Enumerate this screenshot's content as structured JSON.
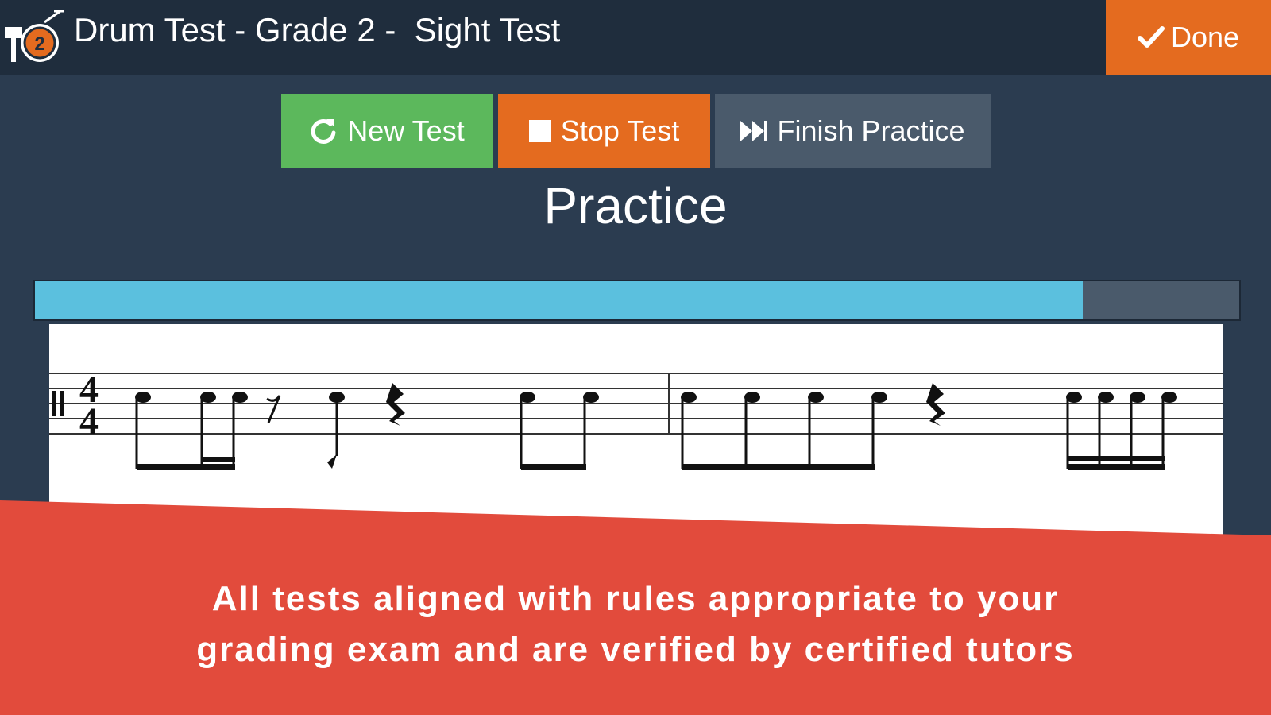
{
  "header": {
    "title": "Drum Test - Grade 2 -  Sight Test",
    "logo_icon": "drum-grade-icon",
    "logo_badge": "2",
    "done_label": "Done",
    "done_icon": "checkmark-icon"
  },
  "toolbar": {
    "new_test_label": "New Test",
    "new_test_icon": "refresh-icon",
    "stop_test_label": "Stop Test",
    "stop_test_icon": "stop-square-icon",
    "finish_label": "Finish Practice",
    "finish_icon": "fast-forward-icon"
  },
  "main": {
    "section_title": "Practice",
    "progress_fraction": 0.87,
    "time_signature": {
      "top": "4",
      "bottom": "4"
    }
  },
  "banner": {
    "line1": "All tests aligned with rules appropriate to your",
    "line2": "grading exam and are verified by certified tutors"
  },
  "colors": {
    "background": "#2b3c50",
    "topbar": "#1f2d3d",
    "accent_orange": "#e46b1f",
    "accent_green": "#5cb85c",
    "button_gray": "#4a5a6b",
    "progress": "#5bc0de",
    "banner_red": "#e24b3c"
  }
}
